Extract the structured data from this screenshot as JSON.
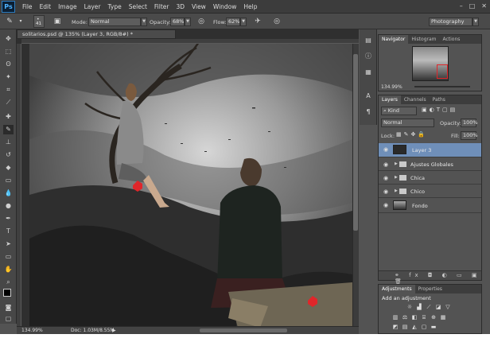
{
  "app": {
    "logo": "Ps"
  },
  "menu": [
    "File",
    "Edit",
    "Image",
    "Layer",
    "Type",
    "Select",
    "Filter",
    "3D",
    "View",
    "Window",
    "Help"
  ],
  "options": {
    "brush_size": "41",
    "mode_label": "Mode:",
    "mode_value": "Normal",
    "opacity_label": "Opacity:",
    "opacity_value": "68%",
    "flow_label": "Flow:",
    "flow_value": "62%",
    "workspace": "Photography"
  },
  "document": {
    "tab_title": "solitarios.psd @ 135% (Layer 3, RGB/8#) *",
    "zoom": "134.99%",
    "doc_size": "Doc: 1.03M/8.55M"
  },
  "navigator": {
    "tabs": [
      "Navigator",
      "Histogram",
      "Actions"
    ],
    "zoom": "134.99%"
  },
  "layers_panel": {
    "tabs": [
      "Layers",
      "Channels",
      "Paths"
    ],
    "filter": "Kind",
    "blend_mode": "Normal",
    "opacity_label": "Opacity:",
    "opacity_value": "100%",
    "lock_label": "Lock:",
    "fill_label": "Fill:",
    "fill_value": "100%",
    "layers": [
      {
        "name": "Layer 3",
        "type": "layer",
        "selected": true
      },
      {
        "name": "Ajustes Globales",
        "type": "group"
      },
      {
        "name": "Chica",
        "type": "group"
      },
      {
        "name": "Chico",
        "type": "group"
      },
      {
        "name": "Fondo",
        "type": "layer"
      }
    ]
  },
  "adjustments_panel": {
    "tabs": [
      "Adjustments",
      "Properties"
    ],
    "title": "Add an adjustment"
  },
  "colors": {
    "selection": "#6f8fb9",
    "accent": "#2e7ec2",
    "marker": "#e0262a"
  }
}
